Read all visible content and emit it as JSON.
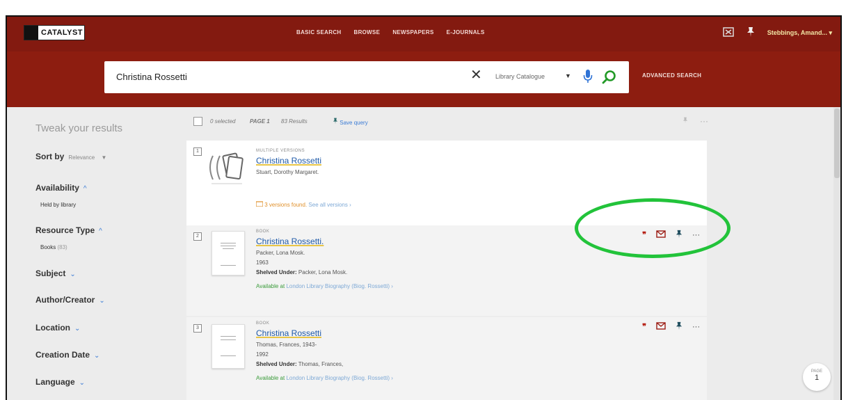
{
  "header": {
    "logo_text": "CATALYST",
    "nav": [
      "BASIC SEARCH",
      "BROWSE",
      "NEWSPAPERS",
      "E-JOURNALS"
    ],
    "user": "Stebbings, Amand...",
    "user_caret": "▾",
    "library_card_icon": "library-card-icon",
    "pin_icon": "pin-icon"
  },
  "search": {
    "query": "Christina Rossetti",
    "clear": "✕",
    "scope": "Library Catalogue",
    "scope_caret": "▼",
    "advanced": "ADVANCED SEARCH"
  },
  "sidebar": {
    "title": "Tweak your results",
    "sort_label": "Sort by",
    "sort_value": "Relevance",
    "sort_caret": "▼",
    "availability": "Availability",
    "availability_chev": "^",
    "held": "Held by library",
    "resource_type": "Resource Type",
    "resource_chev": "^",
    "books": "Books",
    "books_count": "(83)",
    "subject": "Subject",
    "author": "Author/Creator",
    "location": "Location",
    "creation_date": "Creation Date",
    "language": "Language",
    "down_chev": "⌄"
  },
  "toolbar": {
    "selected": "0 selected",
    "page": "PAGE 1",
    "results": "83 Results",
    "save_query": "Save query",
    "more": "···"
  },
  "results": [
    {
      "type": "MULTIPLE VERSIONS",
      "title": "Christina Rossetti",
      "author": "Stuart, Dorothy Margaret.",
      "versions": "3 versions found.",
      "see_all": "See all versions",
      "arrow": "›"
    },
    {
      "type": "BOOK",
      "title": "Christina Rossetti.",
      "author": "Packer, Lona Mosk.",
      "year": "1963",
      "shelved_label": "Shelved Under:",
      "shelved": "Packer, Lona Mosk.",
      "available": "Available at",
      "location": "London Library Biography (Biog. Rossetti)",
      "arrow": "›"
    },
    {
      "type": "BOOK",
      "title": "Christina Rossetti",
      "author": "Thomas, Frances, 1943-",
      "year": "1992",
      "shelved_label": "Shelved Under:",
      "shelved": "Thomas, Frances,",
      "available": "Available at",
      "location": "London Library Biography (Biog. Rossetti)",
      "arrow": "›"
    }
  ],
  "actions": {
    "cite": "❞",
    "email": "✉",
    "pin": "📌",
    "more": "···"
  },
  "page_badge": {
    "label": "PAGE",
    "number": "1"
  },
  "colors": {
    "header": "#831a10",
    "search_band": "#8d1d10",
    "highlight": "#22c33a",
    "link": "#1f5aa8"
  }
}
